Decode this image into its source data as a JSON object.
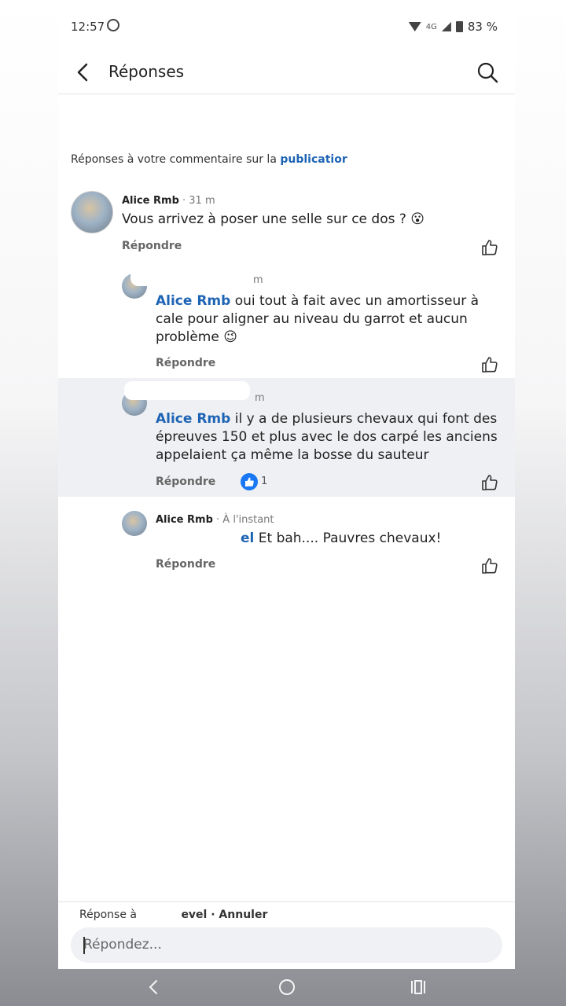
{
  "status": {
    "time": "12:57",
    "network": "4G",
    "battery": "83 %"
  },
  "header": {
    "title": "Réponses"
  },
  "context": {
    "prefix": "Réponses à votre commentaire sur la ",
    "link": "publicatior"
  },
  "comments": [
    {
      "author": "Alice Rmb",
      "time": " · 31 m",
      "text": "Vous arrivez à poser une selle sur ce dos ? 😮",
      "reply": "Répondre"
    },
    {
      "author": "",
      "time": "m",
      "tag": "Alice Rmb",
      "text": " oui tout à fait  avec un amortisseur à cale pour aligner au niveau du garrot et aucun problème 😉",
      "reply": "Répondre"
    },
    {
      "author": "",
      "time": "m",
      "tag": "Alice Rmb",
      "text": " il y a de plusieurs chevaux qui font des épreuves 150 et plus avec le dos carpé les anciens appelaient ça même la bosse du sauteur",
      "reply": "Répondre",
      "reactions": "1"
    },
    {
      "author": "Alice Rmb",
      "time": " · À l'instant",
      "tag": "el",
      "text": " Et bah.... Pauvres chevaux!",
      "reply": "Répondre"
    }
  ],
  "composer": {
    "replying_prefix": "Réponse à ",
    "replying_name": "evel",
    "cancel": " · Annuler",
    "placeholder": "Répondez..."
  },
  "icons": {
    "back": "chevron-left-icon",
    "search": "search-icon",
    "like": "thumbs-up-icon"
  },
  "colors": {
    "link": "#1e64b4",
    "reaction": "#1877f2"
  }
}
